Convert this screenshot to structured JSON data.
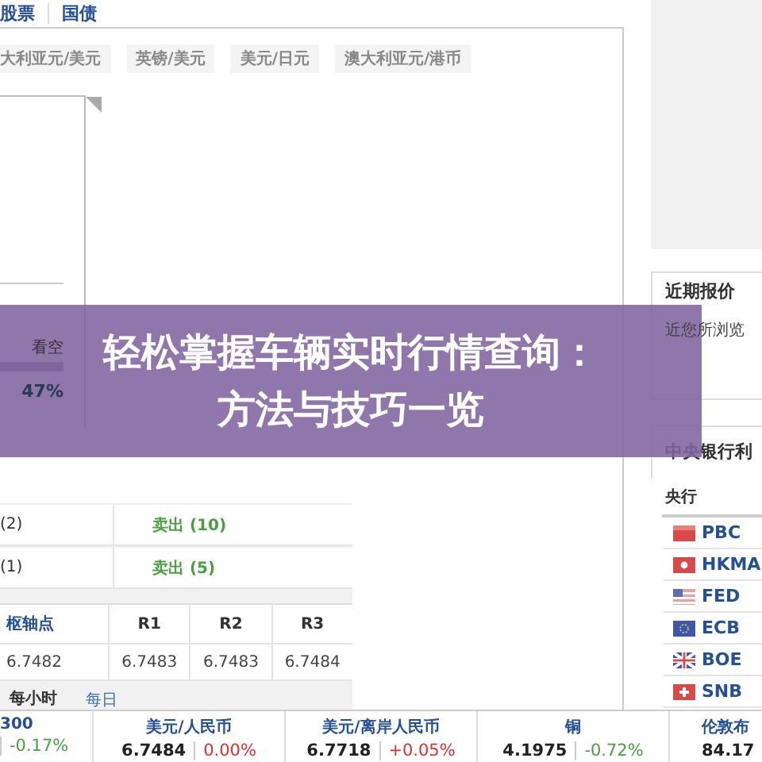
{
  "top_nav": [
    {
      "label": "股票"
    },
    {
      "label": "国债"
    }
  ],
  "pair_tabs": [
    {
      "label": "大利亚元/美元"
    },
    {
      "label": "英镑/美元"
    },
    {
      "label": "美元/日元"
    },
    {
      "label": "澳大利亚元/港币"
    }
  ],
  "sentiment": {
    "label": "看空",
    "reading": "47%"
  },
  "signals": [
    {
      "count": "(2)",
      "action": "卖出 (10)"
    },
    {
      "count": "(1)",
      "action": "卖出 (5)"
    }
  ],
  "pivot_table": {
    "columns": [
      "枢轴点",
      "R1",
      "R2",
      "R3"
    ],
    "rows": [
      [
        "6.7482",
        "6.7483",
        "6.7483",
        "6.7484"
      ]
    ]
  },
  "period_tabs": [
    {
      "label": "每小时",
      "selected": true
    },
    {
      "label": "每日",
      "selected": false
    }
  ],
  "sidebar": {
    "recent": {
      "title": "近期报价",
      "note": "近您所浏览"
    },
    "central_banks": {
      "title": "中央银行利",
      "column": "央行",
      "banks": [
        {
          "code": "PBC",
          "kind": "cn"
        },
        {
          "code": "HKMA",
          "kind": "hk"
        },
        {
          "code": "FED",
          "kind": "us"
        },
        {
          "code": "ECB",
          "kind": "eu"
        },
        {
          "code": "BOE",
          "kind": "uk"
        },
        {
          "code": "SNB",
          "kind": "ch"
        }
      ]
    }
  },
  "ticker": [
    {
      "name": "300",
      "change": "-0.17%",
      "color": "#4aa040"
    },
    {
      "name": "美元/人民币",
      "price": "6.7484",
      "change": "0.00%",
      "color": "#e03030"
    },
    {
      "name": "美元/离岸人民币",
      "price": "6.7718",
      "change": "+0.05%",
      "color": "#e03030"
    },
    {
      "name": "铜",
      "price": "4.1975",
      "change": "-0.72%",
      "color": "#4aa040"
    },
    {
      "name": "伦敦布",
      "price": "84.17"
    }
  ],
  "banner": {
    "lines": [
      "轻松掌握车辆实时行情查询：",
      "方法与技巧一览"
    ]
  }
}
